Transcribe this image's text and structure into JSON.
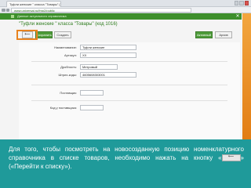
{
  "browser": {
    "tab_title": "Туфли женские \" класса \"Товары\" (код 1016)",
    "url": "www.universal.ru/fmp2/public",
    "close_glyph": "✕"
  },
  "page": {
    "header_title": "Данные актуального справочника",
    "doc_title": "\"Туфли женские \" класса \"Товары\" (код 1016)"
  },
  "toolbar": {
    "back_label": "⟵",
    "save_label": "Сохранить",
    "create_label": "Создать",
    "active_label": "Активный",
    "archive_label": "Архив"
  },
  "form": {
    "name_label": "Наименование:",
    "name_value": "Туфли женские",
    "article_label": "Артикул:",
    "article_value": "ХХ",
    "fraction_label": "Дробность:",
    "fraction_value": "Метровый",
    "barcode_label": "Штрих-коды:",
    "barcode_value": "4605608303001",
    "supplier_label": "Поставщик:",
    "supplier_value": "",
    "unit_label": "Код у поставщика:",
    "unit_value": ""
  },
  "caption": {
    "text_before": "Для того, чтобы посмотреть на новосозданную позицию номенклатурного справочника в списке товаров, необходимо нажать на кнопку «",
    "button_glyph": "⟵",
    "text_after": "» («Перейти к списку»)."
  },
  "colors": {
    "accent_green": "#3d8f2c",
    "highlight_orange": "#e8831f",
    "caption_teal": "#1f9a9a"
  }
}
